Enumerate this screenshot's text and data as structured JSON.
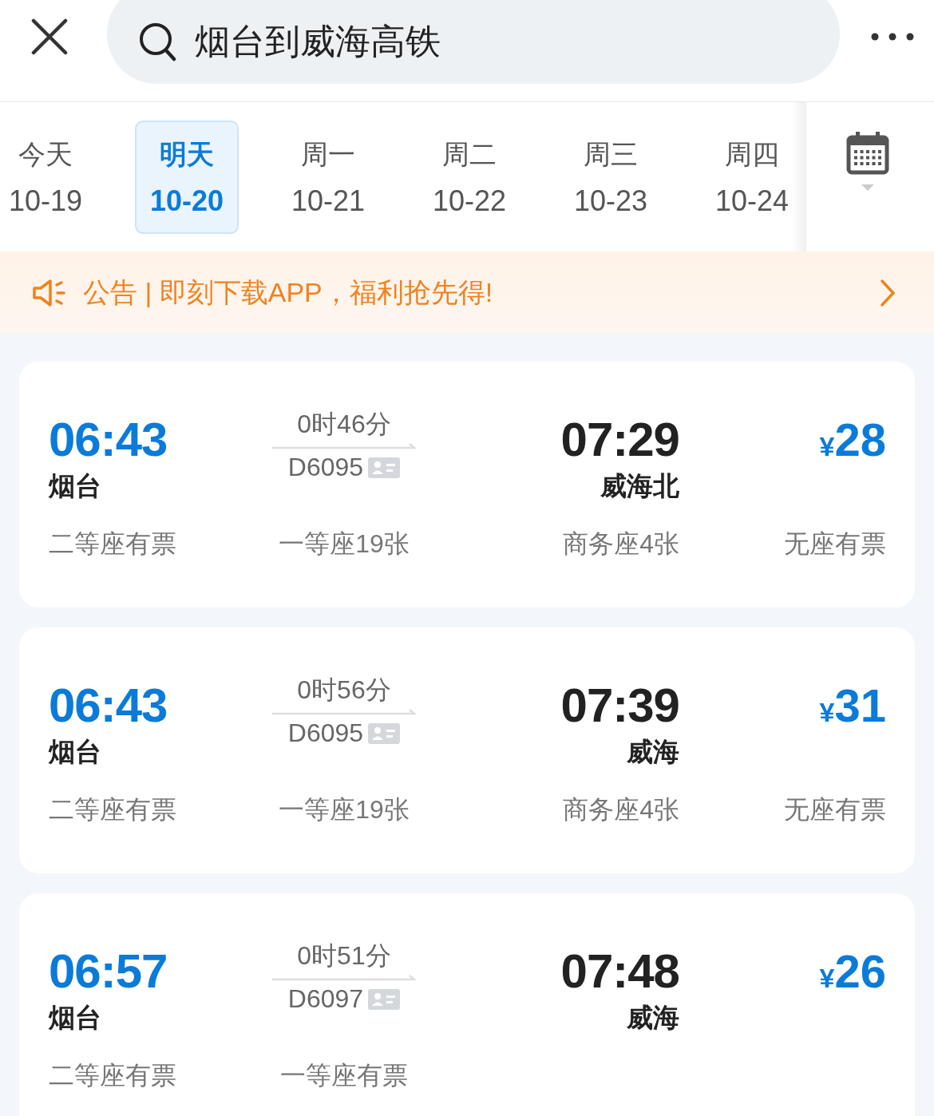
{
  "search": {
    "query": "烟台到威海高铁"
  },
  "dates": [
    {
      "day": "今天",
      "date": "10-19",
      "selected": false
    },
    {
      "day": "明天",
      "date": "10-20",
      "selected": true
    },
    {
      "day": "周一",
      "date": "10-21",
      "selected": false
    },
    {
      "day": "周二",
      "date": "10-22",
      "selected": false
    },
    {
      "day": "周三",
      "date": "10-23",
      "selected": false
    },
    {
      "day": "周四",
      "date": "10-24",
      "selected": false
    }
  ],
  "notice": {
    "text": "公告 | 即刻下载APP，福利抢先得!"
  },
  "trains": [
    {
      "depart_time": "06:43",
      "from": "烟台",
      "duration": "0时46分",
      "number": "D6095",
      "arrive_time": "07:29",
      "to": "威海北",
      "currency": "¥",
      "price": "28",
      "seats": [
        "二等座有票",
        "一等座19张",
        "商务座4张",
        "无座有票"
      ]
    },
    {
      "depart_time": "06:43",
      "from": "烟台",
      "duration": "0时56分",
      "number": "D6095",
      "arrive_time": "07:39",
      "to": "威海",
      "currency": "¥",
      "price": "31",
      "seats": [
        "二等座有票",
        "一等座19张",
        "商务座4张",
        "无座有票"
      ]
    },
    {
      "depart_time": "06:57",
      "from": "烟台",
      "duration": "0时51分",
      "number": "D6097",
      "arrive_time": "07:48",
      "to": "威海",
      "currency": "¥",
      "price": "26",
      "seats": [
        "二等座有票",
        "一等座有票"
      ]
    }
  ]
}
